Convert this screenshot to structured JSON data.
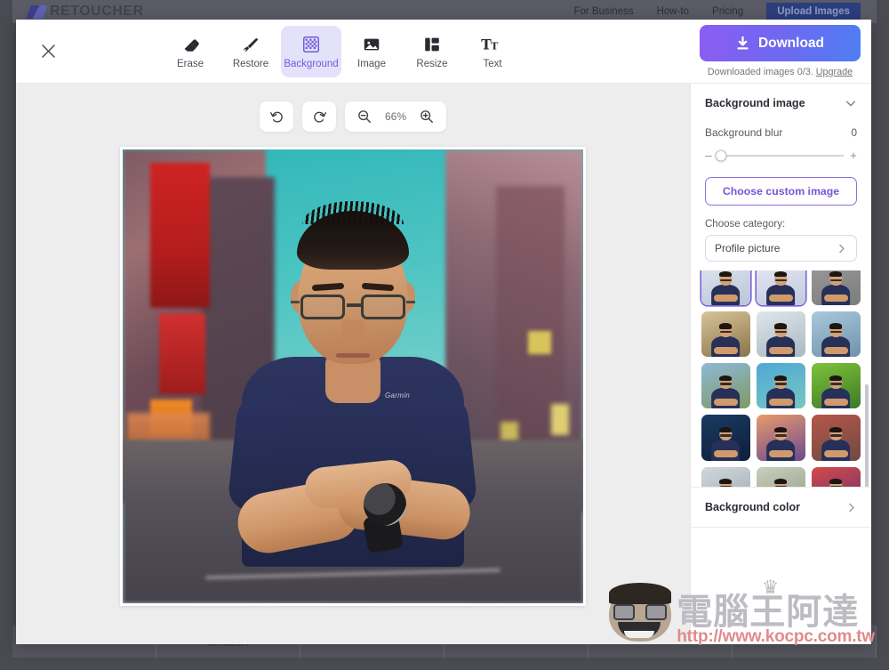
{
  "background_page": {
    "logo_text": "RETOUCHER",
    "nav": [
      {
        "label": "For Business"
      },
      {
        "label": "How-to"
      },
      {
        "label": "Pricing"
      }
    ],
    "upload_button": "Upload Images",
    "footer_logo": "amazon"
  },
  "editor": {
    "close_label": "✕",
    "tools": [
      {
        "name": "erase",
        "label": "Erase",
        "icon": "eraser-icon",
        "active": false
      },
      {
        "name": "restore",
        "label": "Restore",
        "icon": "brush-icon",
        "active": false
      },
      {
        "name": "background",
        "label": "Background",
        "icon": "checkerboard-icon",
        "active": true
      },
      {
        "name": "image",
        "label": "Image",
        "icon": "picture-icon",
        "active": false
      },
      {
        "name": "resize",
        "label": "Resize",
        "icon": "layout-icon",
        "active": false
      },
      {
        "name": "text",
        "label": "Text",
        "icon": "text-icon",
        "active": false
      }
    ],
    "download": {
      "button_label": "Download",
      "icon": "download-icon",
      "meta_prefix": "Downloaded images 0/3.",
      "upgrade_label": "Upgrade",
      "gradient_from": "#8b5cf3",
      "gradient_to": "#4f7ef3"
    },
    "zoom_bar": {
      "undo_icon": "undo-icon",
      "redo_icon": "redo-icon",
      "zoom_out_icon": "zoom-out-icon",
      "zoom_in_icon": "zoom-in-icon",
      "zoom_level": "66%"
    },
    "canvas": {
      "alt": "Portrait of a man with glasses, arms crossed, navy t-shirt, on a blurred city street background",
      "shirt_logo": "Garmin"
    }
  },
  "sidebar": {
    "background_image_section": {
      "title": "Background image",
      "chevron": "chevron-down-icon",
      "blur": {
        "label": "Background blur",
        "value": "0",
        "minus": "–",
        "plus": "+",
        "percent": 2
      },
      "choose_custom_label": "Choose custom image",
      "choose_category_label": "Choose category:",
      "category_value": "Profile picture",
      "category_chevron": "chevron-right-icon",
      "accent_color": "#7656d8"
    },
    "thumbnails": [
      {
        "id": "t1",
        "selected": true,
        "bg_from": "#dfe7ef",
        "bg_to": "#b9c6d6",
        "row": 0
      },
      {
        "id": "t2",
        "selected": true,
        "bg_from": "#e6e9f3",
        "bg_to": "#c3c9de",
        "row": 0
      },
      {
        "id": "t3",
        "selected": false,
        "bg_from": "#9b9b9b",
        "bg_to": "#7c7c7c",
        "row": 0
      },
      {
        "id": "t4",
        "selected": false,
        "bg_from": "#d8c49a",
        "bg_to": "#8a7448",
        "row": 1
      },
      {
        "id": "t5",
        "selected": false,
        "bg_from": "#dfe6ea",
        "bg_to": "#a8b8c2",
        "row": 1
      },
      {
        "id": "t6",
        "selected": false,
        "bg_from": "#a9c9dc",
        "bg_to": "#6f93ab",
        "row": 1
      },
      {
        "id": "t7",
        "selected": false,
        "bg_from": "#8fb8d8",
        "bg_to": "#7d9a63",
        "row": 2
      },
      {
        "id": "t8",
        "selected": false,
        "bg_from": "#4fa8d4",
        "bg_to": "#76c7c1",
        "row": 2
      },
      {
        "id": "t9",
        "selected": false,
        "bg_from": "#7fc23a",
        "bg_to": "#3d7a26",
        "row": 2
      },
      {
        "id": "t10",
        "selected": false,
        "bg_from": "#1b3a63",
        "bg_to": "#0d1f38",
        "row": 3
      },
      {
        "id": "t11",
        "selected": false,
        "bg_from": "#e89a6a",
        "bg_to": "#6b4a8f",
        "row": 3
      },
      {
        "id": "t12",
        "selected": false,
        "bg_from": "#b6564a",
        "bg_to": "#6e4a42",
        "row": 3
      },
      {
        "id": "t13",
        "selected": false,
        "bg_from": "#cfd8dd",
        "bg_to": "#9aa7ad",
        "row": 4
      },
      {
        "id": "t14",
        "selected": false,
        "bg_from": "#c9cfbe",
        "bg_to": "#8c9a7e",
        "row": 4
      },
      {
        "id": "t15",
        "selected": false,
        "bg_from": "#d14b4b",
        "bg_to": "#6a2f6b",
        "row": 4
      }
    ],
    "background_color_section": {
      "title": "Background color",
      "chevron": "chevron-right-icon"
    }
  },
  "watermark": {
    "crown": "♛",
    "text_cn": "電腦王阿達",
    "url": "http://www.kocpc.com.tw",
    "color": "#bcbcc2",
    "url_color": "#e08a8a"
  }
}
